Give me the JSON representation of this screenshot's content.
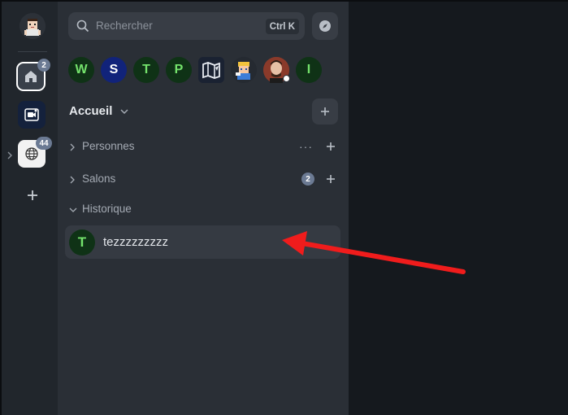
{
  "rail": {
    "spaces": [
      {
        "name": "home",
        "badge": "2"
      },
      {
        "name": "video"
      },
      {
        "name": "globe",
        "badge": "44"
      }
    ]
  },
  "search": {
    "placeholder": "Rechercher",
    "shortcut": "Ctrl K"
  },
  "favourites": [
    {
      "letter": "W",
      "bg": "#0f3216",
      "fg": "#74e36c"
    },
    {
      "letter": "S",
      "bg": "#11237a",
      "fg": "#ffffff"
    },
    {
      "letter": "T",
      "bg": "#0f3216",
      "fg": "#74e36c"
    },
    {
      "letter": "P",
      "bg": "#0f3216",
      "fg": "#74e36c"
    },
    {
      "letter": "",
      "icon": "map-icon",
      "bg": "#1a2232"
    },
    {
      "letter": "",
      "icon": "pixel-avatar",
      "bg": "#e8c35a"
    },
    {
      "letter": "",
      "icon": "photo-avatar",
      "bg": "#8a3a2a"
    },
    {
      "letter": "I",
      "bg": "#0f3216",
      "fg": "#74e36c"
    }
  ],
  "home": {
    "title": "Accueil"
  },
  "sections": {
    "people": {
      "label": "Personnes",
      "more": "···"
    },
    "rooms": {
      "label": "Salons",
      "badge": "2"
    },
    "history": {
      "label": "Historique"
    }
  },
  "room": {
    "avatar_letter": "T",
    "name": "tezzzzzzzzz"
  },
  "colors": {
    "accent_green": "#74e36c",
    "annotation_arrow": "#f01c1c"
  }
}
